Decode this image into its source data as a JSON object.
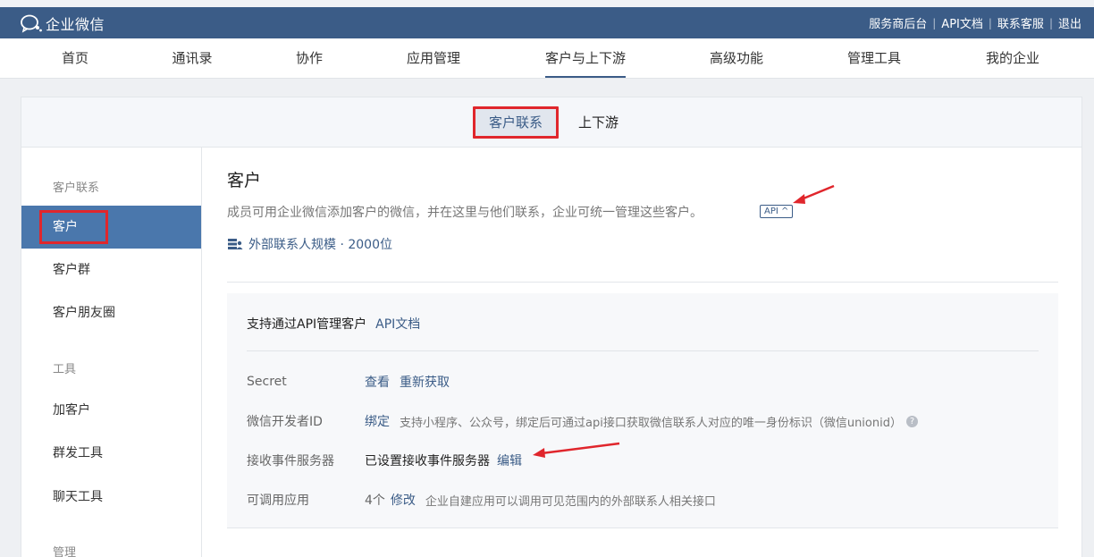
{
  "app": {
    "logo_text": "企业微信"
  },
  "top_links": [
    "服务商后台",
    "API文档",
    "联系客服",
    "退出"
  ],
  "nav": {
    "items": [
      "首页",
      "通讯录",
      "协作",
      "应用管理",
      "客户与上下游",
      "高级功能",
      "管理工具",
      "我的企业"
    ],
    "active": "客户与上下游"
  },
  "subtabs": {
    "customer_contact": "客户联系",
    "upstream_downstream": "上下游"
  },
  "sidebar": {
    "group_customer_contact": "客户联系",
    "item_customer": "客户",
    "item_customer_group": "客户群",
    "item_moments": "客户朋友圈",
    "group_tools": "工具",
    "item_add_customer": "加客户",
    "item_mass_send": "群发工具",
    "item_chat_tools": "聊天工具",
    "group_manage": "管理"
  },
  "content": {
    "title": "客户",
    "description": "成员可用企业微信添加客户的微信，并在这里与他们联系，企业可统一管理这些客户。",
    "api_tag": "API ^",
    "quota": "外部联系人规模 · 2000位"
  },
  "panel": {
    "heading": "支持通过API管理客户",
    "heading_link": "API文档",
    "rows": {
      "secret_label": "Secret",
      "secret_view": "查看",
      "secret_refresh": "重新获取",
      "devid_label": "微信开发者ID",
      "devid_bind": "绑定",
      "devid_note": "支持小程序、公众号，绑定后可通过api接口获取微信联系人对应的唯一身份标识（微信unionid）",
      "devid_help": "?",
      "server_label": "接收事件服务器",
      "server_value": "已设置接收事件服务器",
      "server_edit": "编辑",
      "apps_label": "可调用应用",
      "apps_count": "4个",
      "apps_modify": "修改",
      "apps_note": "企业自建应用可以调用可见范围内的外部联系人相关接口"
    }
  },
  "colors": {
    "brand": "#3b5c87",
    "sidebar_active": "#4a77ac",
    "annotation_red": "#e0262c"
  }
}
